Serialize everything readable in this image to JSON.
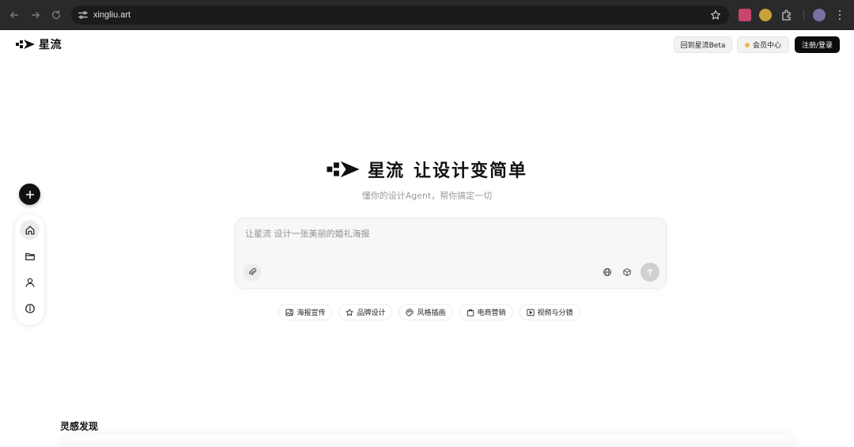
{
  "browser": {
    "url": "xingliu.art"
  },
  "header": {
    "brand": "星流",
    "beta_button": "回到星流Beta",
    "member_button": "会员中心",
    "login_button": "注册/登录"
  },
  "hero": {
    "brand": "星流",
    "slogan": "让设计变简单",
    "subtitle": "懂你的设计Agent，帮你搞定一切"
  },
  "prompt": {
    "placeholder": "让星流 设计一张美丽的婚礼海报",
    "value": ""
  },
  "chips": [
    {
      "label": "海报宣传",
      "icon": "image-icon"
    },
    {
      "label": "品牌设计",
      "icon": "star-icon"
    },
    {
      "label": "风格插画",
      "icon": "palette-icon"
    },
    {
      "label": "电商营销",
      "icon": "shopping-bag-icon"
    },
    {
      "label": "视频与分镜",
      "icon": "play-icon"
    }
  ],
  "sidebar": {
    "items": [
      {
        "icon": "home-icon",
        "active": true
      },
      {
        "icon": "folder-icon",
        "active": false
      },
      {
        "icon": "user-icon",
        "active": false
      },
      {
        "icon": "info-icon",
        "active": false
      }
    ]
  },
  "inspiration": {
    "title": "灵感发现"
  },
  "colors": {
    "chrome_bg": "#2a2a2c",
    "primary": "#111111",
    "member_dot": "#f6b545",
    "muted_text": "#9a9a9e"
  }
}
